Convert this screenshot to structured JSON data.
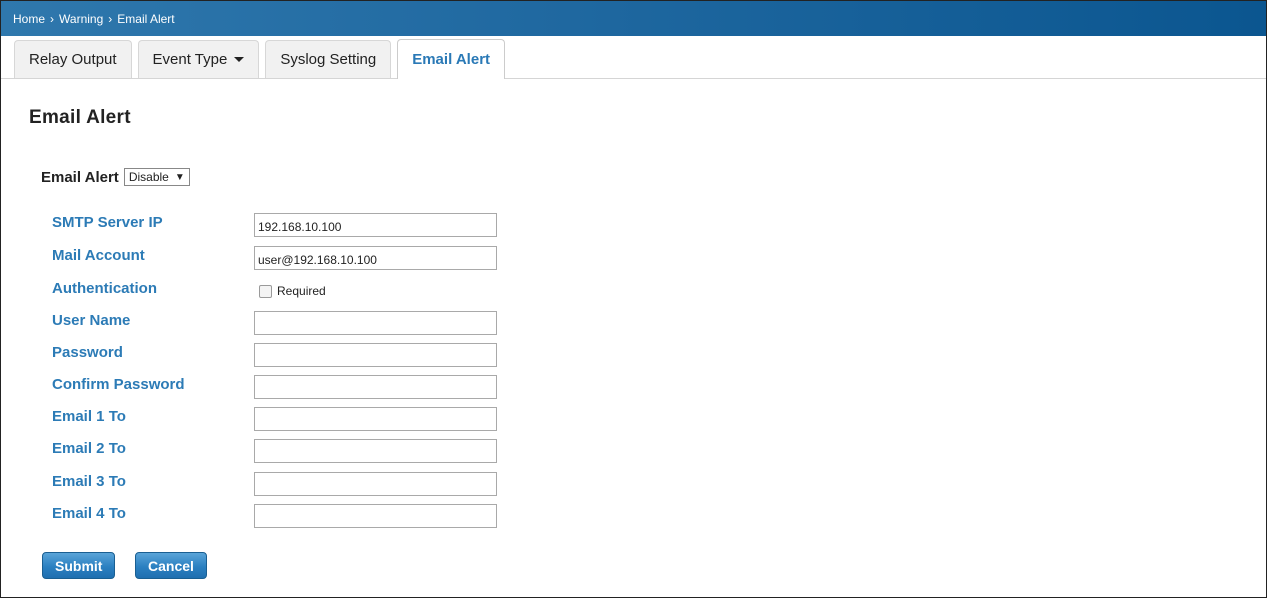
{
  "breadcrumb": {
    "items": [
      "Home",
      "Warning",
      "Email Alert"
    ],
    "separator": "›"
  },
  "tabs": [
    {
      "label": "Relay Output"
    },
    {
      "label": "Event Type",
      "dropdown": true
    },
    {
      "label": "Syslog Setting"
    },
    {
      "label": "Email Alert",
      "active": true
    }
  ],
  "page": {
    "title": "Email Alert"
  },
  "email_alert": {
    "label": "Email Alert",
    "selected": "Disable"
  },
  "fields": {
    "smtp_server_ip": {
      "label": "SMTP Server IP",
      "value": "192.168.10.100"
    },
    "mail_account": {
      "label": "Mail Account",
      "value": "user@192.168.10.100"
    },
    "authentication": {
      "label": "Authentication",
      "checkbox_label": "Required",
      "checked": false
    },
    "user_name": {
      "label": "User Name",
      "value": ""
    },
    "password": {
      "label": "Password",
      "value": ""
    },
    "confirm_password": {
      "label": "Confirm Password",
      "value": ""
    },
    "email_1_to": {
      "label": "Email 1 To",
      "value": ""
    },
    "email_2_to": {
      "label": "Email 2 To",
      "value": ""
    },
    "email_3_to": {
      "label": "Email 3 To",
      "value": ""
    },
    "email_4_to": {
      "label": "Email 4 To",
      "value": ""
    }
  },
  "buttons": {
    "submit": "Submit",
    "cancel": "Cancel"
  },
  "colors": {
    "header_blue": "#1f68a0",
    "label_blue": "#2c7bb6",
    "button_blue": "#2b80c1"
  }
}
